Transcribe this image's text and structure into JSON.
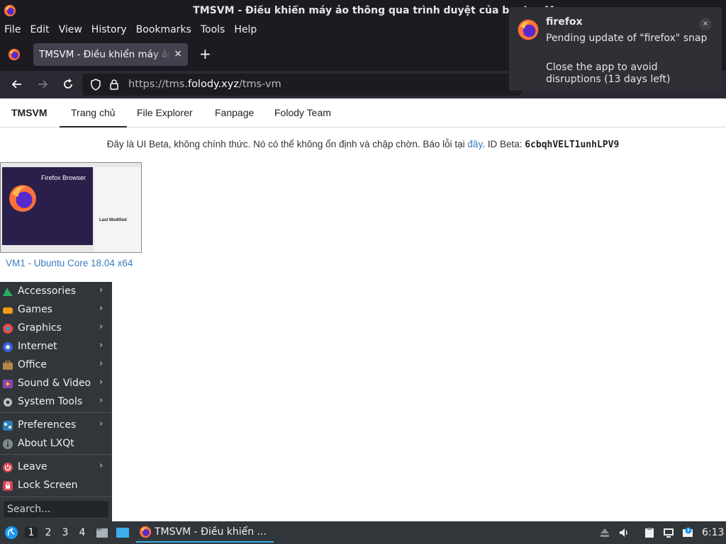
{
  "window": {
    "title": "TMSVM - Điều khiển máy ảo thông qua trình duyệt của bạn! — M"
  },
  "menubar": [
    "File",
    "Edit",
    "View",
    "History",
    "Bookmarks",
    "Tools",
    "Help"
  ],
  "tab": {
    "label": "TMSVM - Điều khiển máy ảo",
    "close": "×",
    "new": "+"
  },
  "url": {
    "prefix": "https://tms.",
    "host": "folody.xyz",
    "path": "/tms-vm"
  },
  "sitenav": {
    "brand": "TMSVM",
    "items": [
      "Trang chủ",
      "File Explorer",
      "Fanpage",
      "Folody Team"
    ]
  },
  "notice": {
    "text": "Đây là UI Beta, không chính thức. Nó có thể không ổn định và chập chờn. Báo lỗi tại ",
    "link": "đây",
    "id_label": ". ID Beta: ",
    "id_value": "6cbqhVELT1unhLPV9"
  },
  "vm": {
    "name": "VM1 - Ubuntu Core 18.04 x64",
    "thumb_title": "Firefox Browser",
    "thumb_label": "Last Modified"
  },
  "notification": {
    "app": "firefox",
    "line1": "Pending update of \"firefox\" snap",
    "line2": "Close the app to avoid disruptions (13 days left)",
    "close": "×"
  },
  "menu": {
    "items": [
      {
        "label": "Accessories",
        "color": "#27ae60"
      },
      {
        "label": "Games",
        "color": "#f39c12"
      },
      {
        "label": "Graphics",
        "color": "#e74c3c"
      },
      {
        "label": "Internet",
        "color": "#3b5fd8"
      },
      {
        "label": "Office",
        "color": "#b5854a"
      },
      {
        "label": "Sound & Video",
        "color": "#8e44ad"
      },
      {
        "label": "System Tools",
        "color": "#bdc3c7"
      },
      {
        "label": "Preferences",
        "color": "#2980b9"
      },
      {
        "label": "About LXQt",
        "color": "#7f8c8d"
      },
      {
        "label": "Leave",
        "color": "#da4453"
      },
      {
        "label": "Lock Screen",
        "color": "#da4453"
      }
    ],
    "search_placeholder": "Search..."
  },
  "taskbar": {
    "desktops": [
      "1",
      "2",
      "3",
      "4"
    ],
    "task_label": "TMSVM - Điều khiển ...",
    "clock": "6:13"
  }
}
